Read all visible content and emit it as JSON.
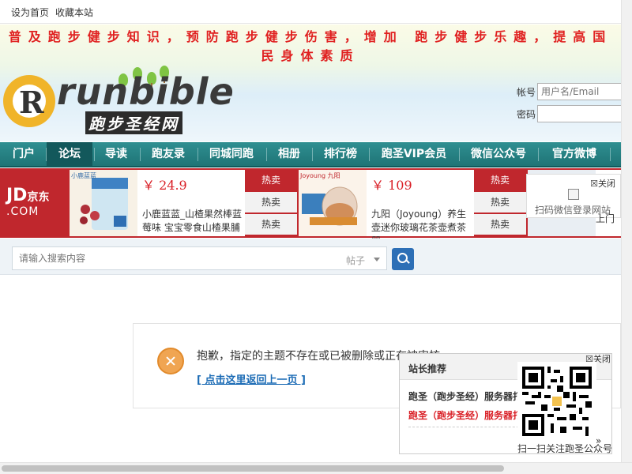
{
  "toplinks": {
    "set_home": "设为首页",
    "bookmark": "收藏本站"
  },
  "header": {
    "slogan": "普及跑步健步知识，预防跑步健步伤害，增加 跑步健步乐趣，提高国民身体素质",
    "logo_mark": "R",
    "logo_word": "runbible",
    "logo_sub": "跑步圣经网",
    "login": {
      "account_label": "帐号",
      "account_placeholder": "用户名/Email",
      "password_label": "密码"
    }
  },
  "nav": {
    "items": [
      "门户",
      "论坛",
      "导读",
      "跑友录",
      "同城同跑",
      "相册",
      "排行榜",
      "跑圣VIP会员",
      "微信公众号",
      "官方微博"
    ],
    "active_index": 1
  },
  "ads": {
    "brand": "JD",
    "brand_cn": "京东",
    "brand_tld": ".COM",
    "items": [
      {
        "price": "￥ 24.9",
        "title": "小鹿蓝蓝_山楂果然棒蓝莓味 宝宝零食山楂果脯",
        "img_label": "小鹿蓝蓝"
      },
      {
        "price": "￥ 109",
        "title": "九阳（Joyoung）养生壶迷你玻璃花茶壶煮茶器",
        "img_label": "Joyoung 九阳"
      }
    ],
    "hot_label": "热卖",
    "right_clip": "上门",
    "qr_popup": {
      "close": "关闭",
      "text": "扫码微信登录网站"
    }
  },
  "search": {
    "placeholder": "请输入搜索内容",
    "type": "帖子"
  },
  "message": {
    "text": "抱歉，指定的主题不存在或已被删除或正在被审核",
    "back": "[ 点击这里返回上一页 ]"
  },
  "recommend": {
    "title": "站长推荐",
    "close": "关闭",
    "line1": "跑圣（跑步圣经）服务器打",
    "line2": "跑圣（跑步圣经）服务器打",
    "more": "»",
    "qr_text": "扫一扫关注跑圣公众号"
  },
  "colors": {
    "nav": "#1f7476",
    "ad": "#c0272d",
    "slogan": "#e02020",
    "link": "#1b6bb5"
  }
}
